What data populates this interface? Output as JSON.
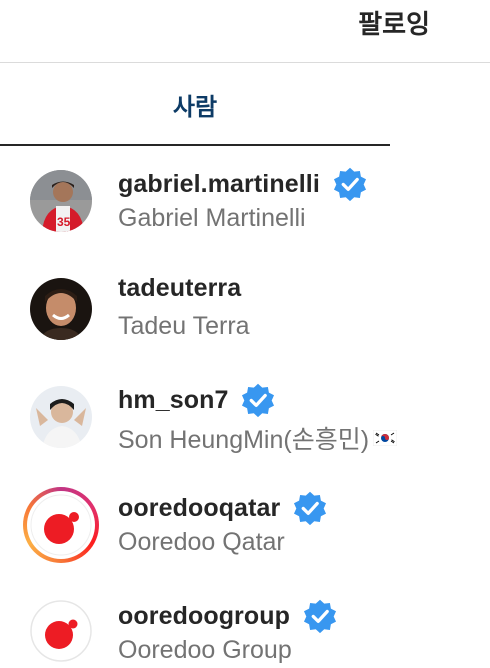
{
  "header": {
    "title": "팔로잉"
  },
  "tabs": {
    "people_label": "사람"
  },
  "accounts": [
    {
      "username": "gabriel.martinelli",
      "full_name": "Gabriel Martinelli",
      "verified": true,
      "story_ring": false
    },
    {
      "username": "tadeuterra",
      "full_name": "Tadeu Terra",
      "verified": false,
      "story_ring": false
    },
    {
      "username": "hm_son7",
      "full_name": "Son HeungMin(손흥민)",
      "verified": true,
      "story_ring": false,
      "name_suffix_icon": "south-korea-flag"
    },
    {
      "username": "ooredooqatar",
      "full_name": "Ooredoo Qatar",
      "verified": true,
      "story_ring": true
    },
    {
      "username": "ooredoogroup",
      "full_name": "Ooredoo Group",
      "verified": true,
      "story_ring": false
    }
  ],
  "colors": {
    "verified_blue": "#3897f0",
    "tab_text": "#0d3b66",
    "ooredoo_red": "#ed1c24",
    "secondary_text": "#737373"
  }
}
